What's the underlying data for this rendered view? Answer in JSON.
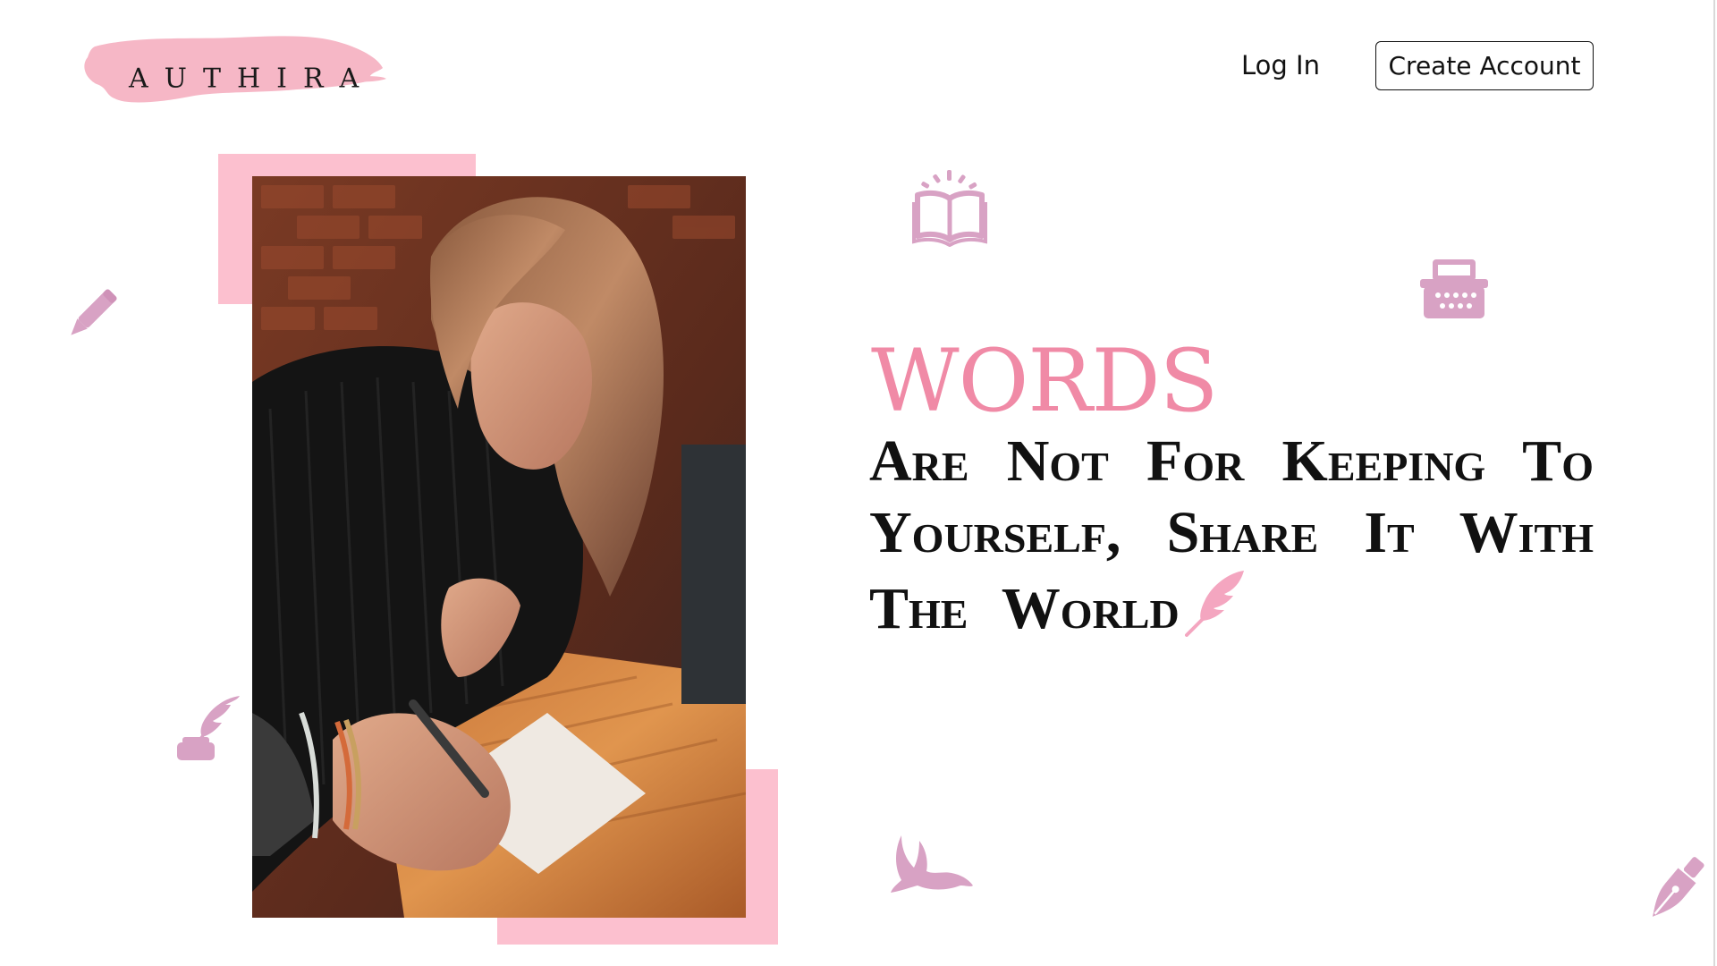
{
  "brand": {
    "logo_text": "AUTHIRA",
    "accent_color": "#fcc0cf",
    "headline_color": "#f08aa6",
    "icon_color": "#d8a2c4"
  },
  "nav": {
    "login_label": "Log In",
    "create_label": "Create Account"
  },
  "hero": {
    "headline_main": "WORDS",
    "headline_sub": "Are Not For Keeping To Yourself, Share It With The World",
    "image": "woman-writing-in-notebook-photo"
  },
  "icons": [
    "pencil-icon",
    "open-book-icon",
    "typewriter-icon",
    "quill-icon",
    "inkwell-quill-icon",
    "bird-icon",
    "fountain-pen-icon"
  ]
}
